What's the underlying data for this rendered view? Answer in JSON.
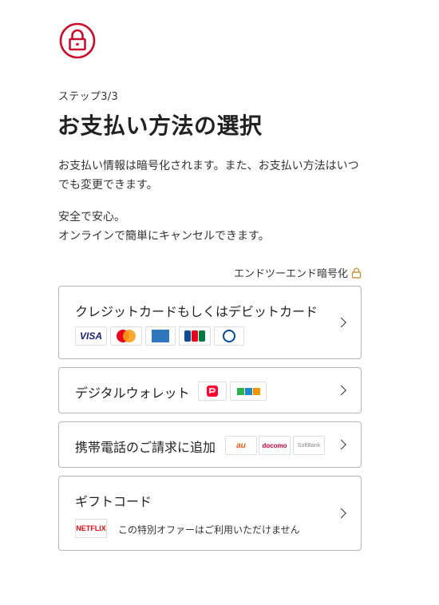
{
  "step_label": "ステップ3/3",
  "page_title": "お支払い方法の選択",
  "description_1": "お支払い情報は暗号化されます。また、お支払い方法はいつでも変更できます。",
  "description_2_line1": "安全で安心。",
  "description_2_line2": "オンラインで簡単にキャンセルできます。",
  "encryption_label": "エンドツーエンド暗号化",
  "options": [
    {
      "label": "クレジットカードもしくはデビットカード",
      "logos": [
        "VISA",
        "mastercard",
        "amex",
        "JCB",
        "Diners Club"
      ]
    },
    {
      "label": "デジタルウォレット",
      "logos": [
        "PayPay",
        "by atone"
      ]
    },
    {
      "label": "携帯電話のご請求に追加",
      "logos": [
        "au UQ mobile",
        "docomo",
        "SoftBank"
      ]
    },
    {
      "label": "ギフトコード",
      "note": "この特別オファーはご利用いただけません",
      "logos": [
        "NETFLIX"
      ]
    }
  ],
  "colors": {
    "accent": "#e50914",
    "lock": "#c8102e",
    "gold_lock": "#c8963e"
  },
  "icons": {
    "header": "lock-icon",
    "encryption": "lock-icon",
    "option": "chevron-right-icon"
  }
}
